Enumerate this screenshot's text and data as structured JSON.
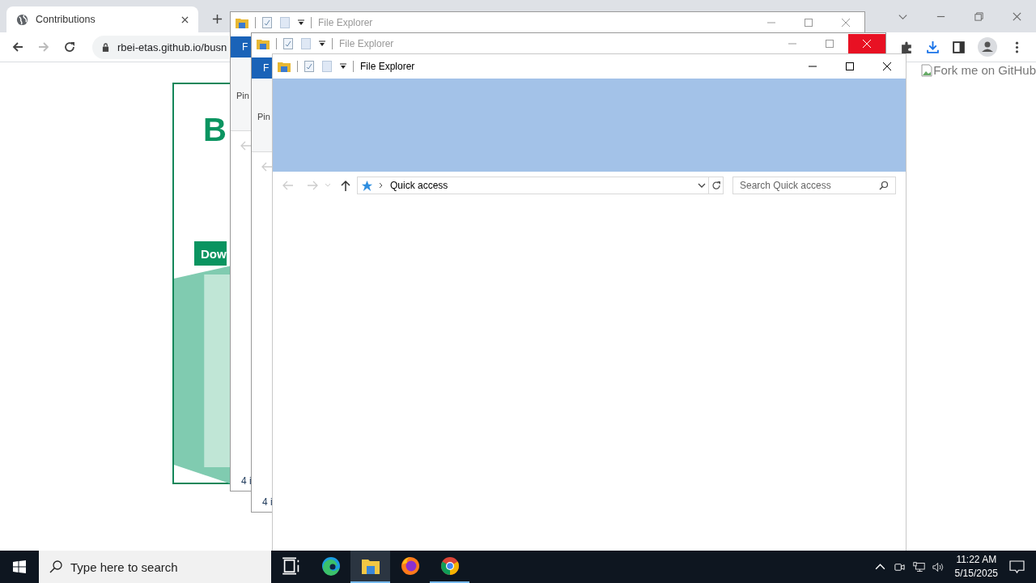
{
  "browser": {
    "tab": {
      "title": "Contributions"
    },
    "address": "rbei-etas.github.io/busn",
    "page": {
      "heading": "B",
      "button": "Dow",
      "fork_image_alt": "Fork me on GitHub"
    }
  },
  "windows": [
    {
      "kind": "background",
      "title": "File Explorer",
      "active": false,
      "close_hover": false,
      "ribbon_tab": "F",
      "ribbon_label": "Pin",
      "status": "4 i"
    },
    {
      "kind": "background",
      "title": "File Explorer",
      "active": false,
      "close_hover": true,
      "ribbon_tab": "F",
      "ribbon_label": "Pin",
      "status": "4 i"
    },
    {
      "kind": "front",
      "title": "File Explorer",
      "active": true,
      "close_hover": false,
      "address": "Quick access",
      "search": {
        "placeholder": "Search Quick access"
      }
    }
  ],
  "taskbar": {
    "search": {
      "placeholder": "Type here to search"
    },
    "apps": [
      {
        "kind": "task-view",
        "running": false,
        "selected": false
      },
      {
        "kind": "edge",
        "running": false,
        "selected": false
      },
      {
        "kind": "explorer",
        "running": true,
        "selected": true
      },
      {
        "kind": "firefox",
        "running": false,
        "selected": false
      },
      {
        "kind": "chrome",
        "running": true,
        "selected": false
      }
    ],
    "time": "11:22 AM",
    "date": "5/15/2025"
  }
}
